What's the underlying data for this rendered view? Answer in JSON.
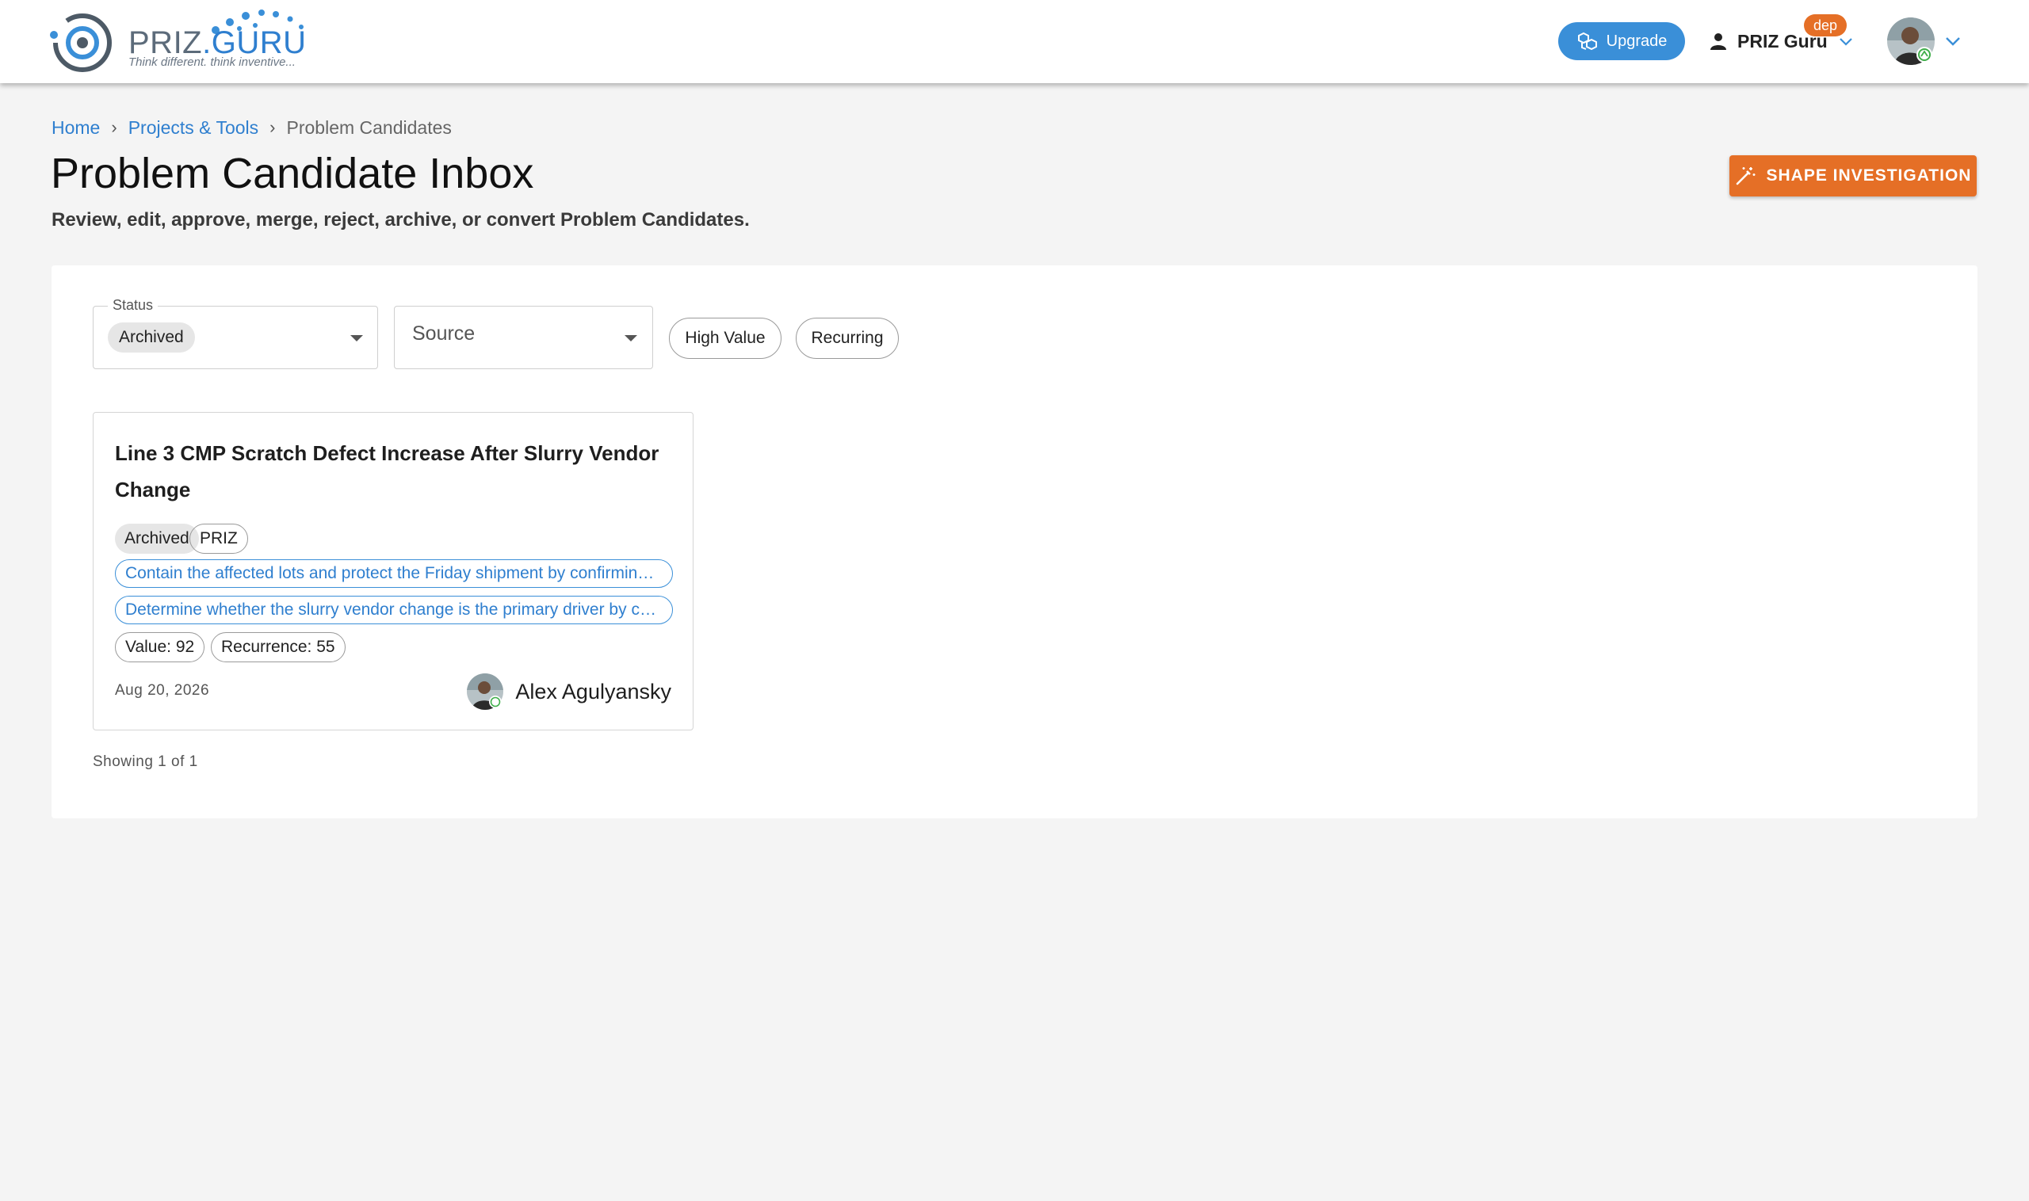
{
  "header": {
    "logo_word_left": "PRIZ",
    "logo_word_right": ".GURU",
    "logo_tagline": "Think different. think inventive...",
    "upgrade_label": "Upgrade",
    "user_name": "PRIZ Guru",
    "env_badge": "dep"
  },
  "breadcrumb": {
    "home": "Home",
    "projects": "Projects & Tools",
    "current": "Problem Candidates"
  },
  "page": {
    "title": "Problem Candidate Inbox",
    "subtitle": "Review, edit, approve, merge, reject, archive, or convert Problem Candidates.",
    "shape_button_label": "SHAPE INVESTIGATION"
  },
  "filters": {
    "status_legend": "Status",
    "status_value": "Archived",
    "source_placeholder": "Source",
    "chip_high_value": "High Value",
    "chip_recurring": "Recurring"
  },
  "cards": [
    {
      "title": "Line 3 CMP Scratch Defect Increase After Slurry Vendor Change",
      "status_tag": "Archived",
      "source_tag": "PRIZ",
      "goal_1": "Contain the affected lots and protect the Friday shipment by confirming which lots are impacted",
      "goal_2": "Determine whether the slurry vendor change is the primary driver by comparing defect data",
      "value_label": "Value: 92",
      "recurrence_label": "Recurrence: 55",
      "date": "Aug 20, 2026",
      "author": "Alex Agulyansky"
    }
  ],
  "footer": {
    "showing": "Showing 1 of 1"
  },
  "colors": {
    "brand_blue": "#3a8fd8",
    "accent_orange": "#e56f26",
    "link_blue": "#2f7fcf"
  }
}
